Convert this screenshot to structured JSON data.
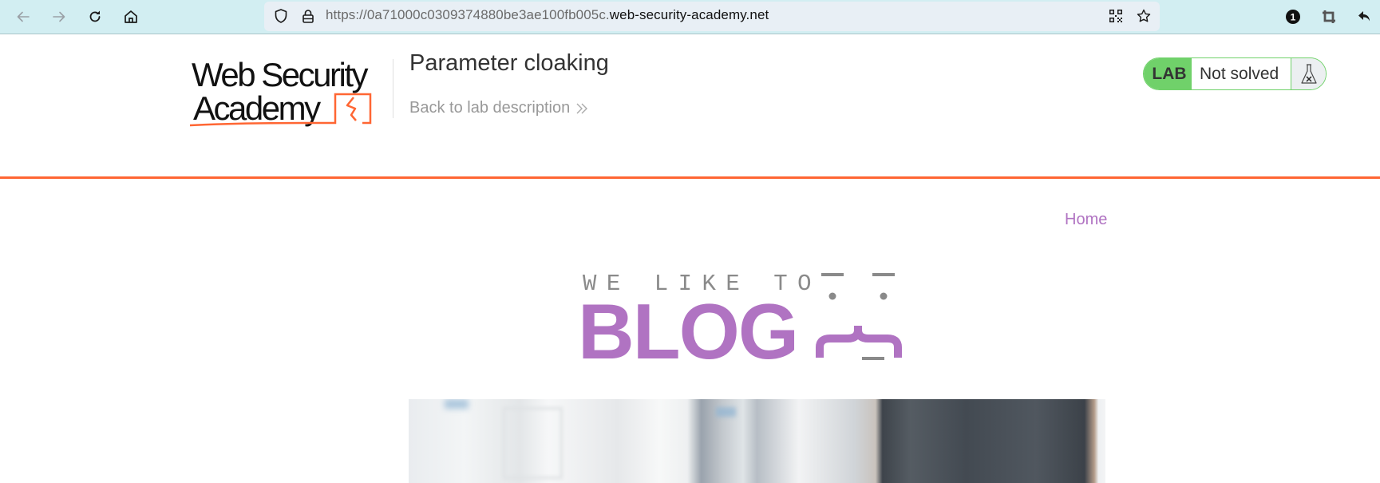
{
  "browser": {
    "nav_icons": [
      "back-arrow-icon",
      "forward-arrow-icon",
      "reload-icon",
      "home-icon"
    ],
    "url_prefix": "https://0a71000c0309374880be3ae100fb005c.",
    "url_domain": "web-security-academy.net",
    "url_icons": [
      "shield-icon",
      "lock-icon",
      "qr-code-icon",
      "star-icon"
    ],
    "extension_badge": "1",
    "right_icons": [
      "extension-badge-icon",
      "crop-icon",
      "undo-icon"
    ]
  },
  "header": {
    "logo_line1": "Web Security",
    "logo_line2": "Academy",
    "lab_title": "Parameter cloaking",
    "back_link": "Back to lab description",
    "badge": {
      "label": "LAB",
      "status": "Not solved",
      "icon": "flask-icon"
    }
  },
  "colors": {
    "accent_orange": "#ff6633",
    "lab_green": "#70d16a",
    "blog_purple": "#b073c2",
    "toolbar_bg": "#d2eef2"
  },
  "nav": {
    "home": "Home"
  },
  "blog": {
    "tagline": "WE LIKE TO",
    "word": "BLOG"
  }
}
